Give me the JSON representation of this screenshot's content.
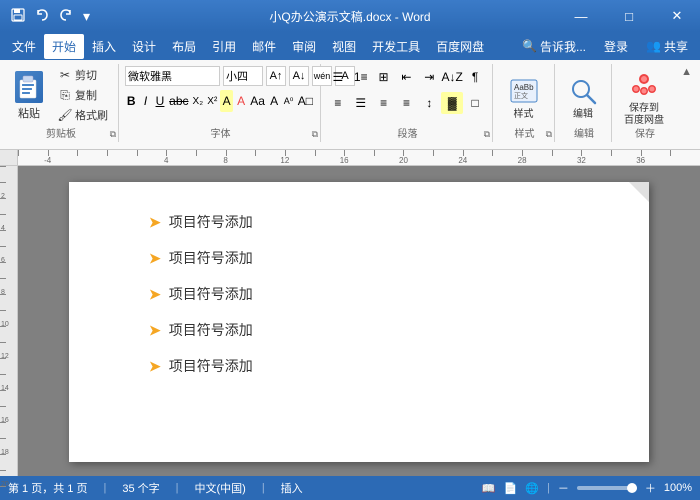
{
  "titlebar": {
    "title": "小Q办公演示文稿.docx - Word",
    "app": "Word",
    "quick_access": [
      "save",
      "undo",
      "redo",
      "customize"
    ],
    "min_label": "—",
    "max_label": "□",
    "close_label": "✕"
  },
  "menubar": {
    "items": [
      "文件",
      "开始",
      "插入",
      "设计",
      "布局",
      "引用",
      "邮件",
      "审阅",
      "视图",
      "开发工具",
      "百度网盘"
    ],
    "active": "开始",
    "right_items": [
      "告诉我...",
      "登录",
      "共享"
    ]
  },
  "ribbon": {
    "groups": [
      {
        "label": "剪贴板",
        "paste_label": "粘贴",
        "cut_label": "剪切",
        "copy_label": "复制",
        "format_label": "格式刷"
      },
      {
        "label": "字体",
        "font_name": "微软雅黑",
        "font_size": "小四",
        "bold": "B",
        "italic": "I",
        "underline": "U"
      },
      {
        "label": "段落"
      },
      {
        "label": "样式",
        "style_label": "样式"
      },
      {
        "label": "编辑",
        "edit_label": "编辑"
      },
      {
        "label": "保存",
        "save_label": "保存到\n百度网盘"
      }
    ]
  },
  "document": {
    "bullet_items": [
      "项目符号添加",
      "项目符号添加",
      "项目符号添加",
      "项目符号添加",
      "项目符号添加"
    ],
    "bullet_arrow": "➤"
  },
  "statusbar": {
    "page_info": "第 1 页，共 1 页",
    "word_count": "35 个字",
    "language": "中文(中国)",
    "input_mode": "插入",
    "zoom": "100%",
    "zoom_minus": "－",
    "zoom_plus": "＋"
  }
}
